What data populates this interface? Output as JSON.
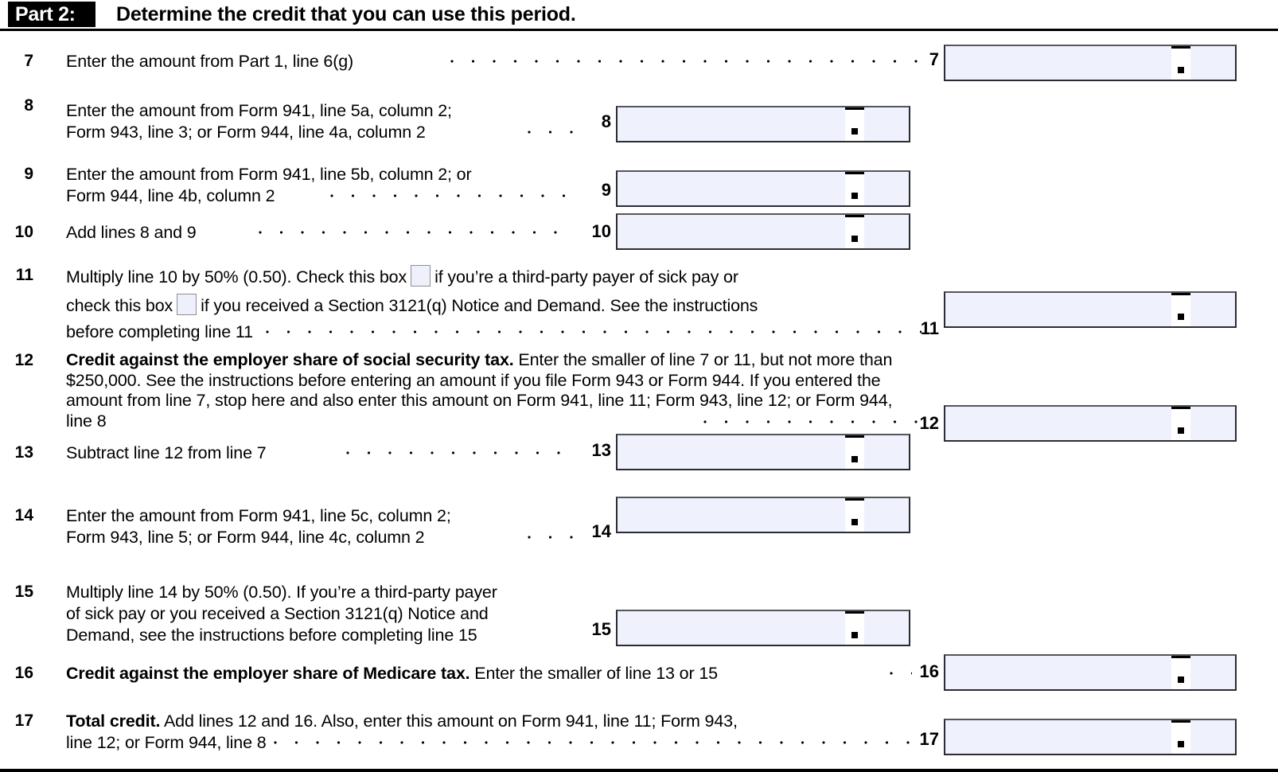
{
  "header": {
    "part_label": "Part 2:",
    "part_title": "Determine the credit that you can use this period."
  },
  "lines": [
    {
      "number": "7",
      "text": "Enter the amount from Part 1, line 6(g)",
      "field_number": "7"
    },
    {
      "number": "8",
      "text_line1": "Enter the amount from Form 941, line 5a, column 2;",
      "text_line2": "Form 943, line 3; or Form 944, line 4a, column 2",
      "field_number": "8"
    },
    {
      "number": "9",
      "text_line1": "Enter the amount from Form 941, line 5b, column 2; or",
      "text_line2": "Form 944, line 4b, column 2",
      "field_number": "9"
    },
    {
      "number": "10",
      "text": "Add lines 8 and 9",
      "field_number": "10"
    },
    {
      "number": "11",
      "text_part1": "Multiply line 10 by 50% (0.50). Check this box",
      "text_part2": "if you’re a third-party payer of sick pay or",
      "text_part3": "check this box",
      "text_part4": "if you received a Section 3121(q) Notice and Demand. See the instructions",
      "text_part5": "before completing line 11",
      "field_number": "11",
      "checkbox1": "third-party-payer-checkbox",
      "checkbox2": "section-3121q-notice-checkbox"
    },
    {
      "number": "12",
      "bold_lead": "Credit against the employer share of social security tax.",
      "text_rest": " Enter the smaller of line 7 or 11, but not more than $250,000. See the instructions before entering an amount if you file Form 943 or Form 944. If you entered the amount from line 7, stop here and also enter this amount on Form 941, line 11; Form 943, line 12; or Form 944, line 8",
      "field_number": "12"
    },
    {
      "number": "13",
      "text": "Subtract line 12 from line 7",
      "field_number": "13"
    },
    {
      "number": "14",
      "text_line1": "Enter the amount from Form 941, line 5c, column 2;",
      "text_line2": "Form 943, line 5; or Form 944, line 4c, column 2",
      "field_number": "14"
    },
    {
      "number": "15",
      "text_line1": "Multiply line 14 by 50% (0.50). If you’re a third-party payer",
      "text_line2": "of sick pay or you received a Section 3121(q) Notice and",
      "text_line3": "Demand, see the instructions before completing line 15",
      "field_number": "15"
    },
    {
      "number": "16",
      "bold_lead": "Credit against the employer share of Medicare tax.",
      "text_rest": " Enter the smaller of line 13 or 15",
      "field_number": "16"
    },
    {
      "number": "17",
      "bold_lead": "Total credit.",
      "text_rest": " Add lines 12 and 16. Also, enter this amount on Form 941, line 11; Form 943,",
      "text_line2": "line 12; or Form 944, line 8",
      "field_number": "17"
    }
  ],
  "colors": {
    "field_background": "#eff2fc",
    "field_border": "#2b2b33",
    "header_badge_background": "#000000",
    "checkbox_background": "#eef1fb",
    "checkbox_border": "#8e8e96"
  }
}
